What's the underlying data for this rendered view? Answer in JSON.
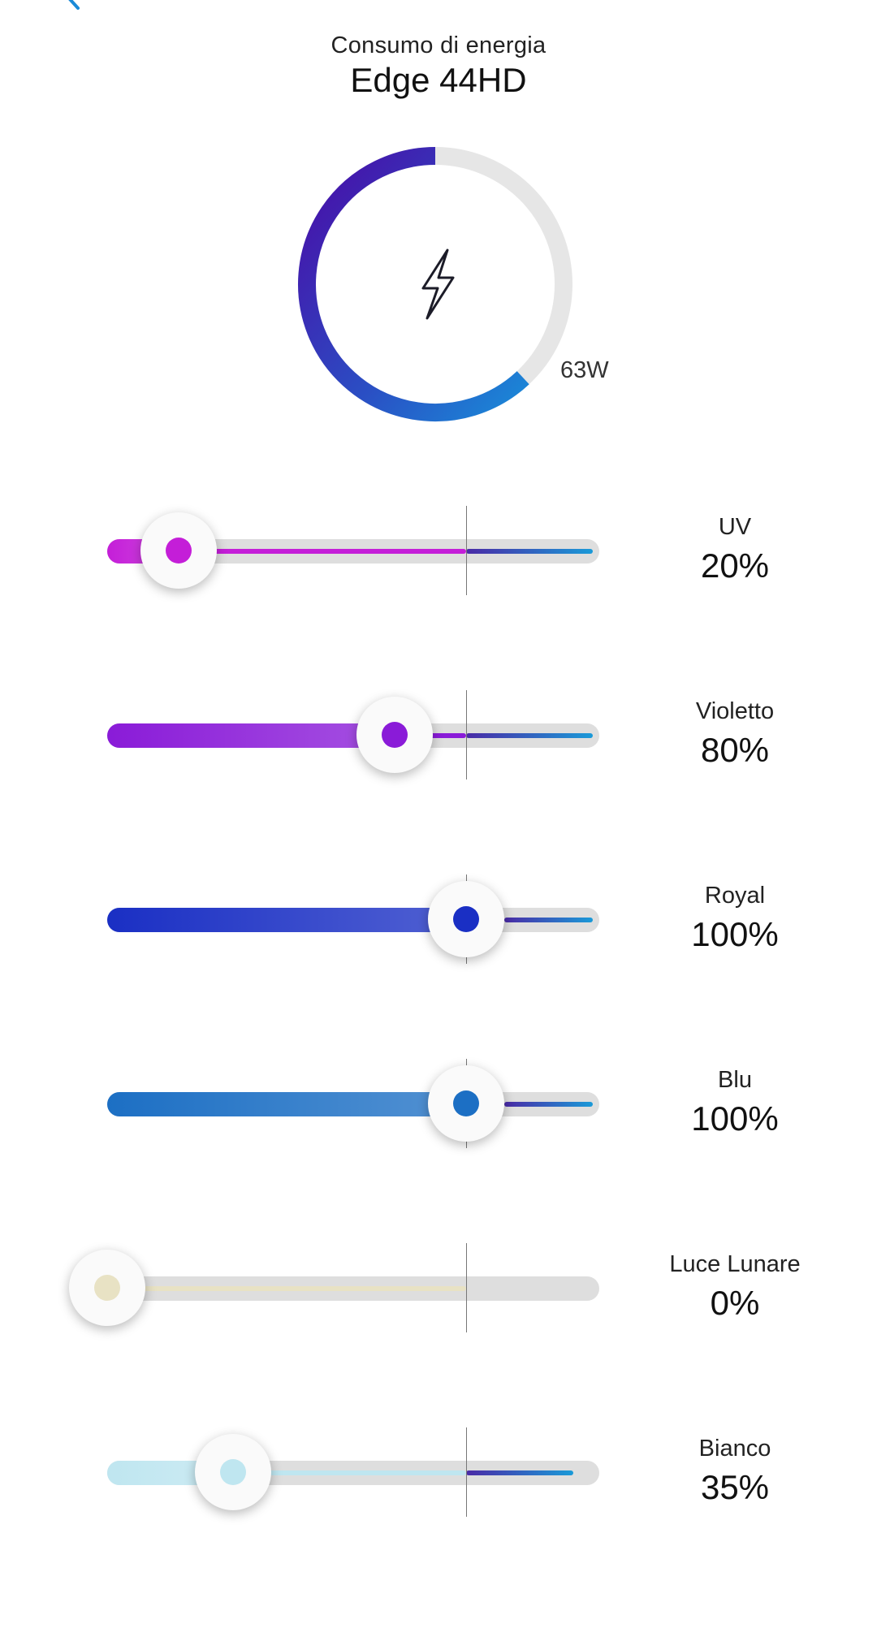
{
  "header": {
    "subtitle": "Consumo di energia",
    "title": "Edge 44HD"
  },
  "power": {
    "value_label": "63W",
    "icon": "lightning-icon",
    "fraction": 0.62
  },
  "channels": [
    {
      "name": "UV",
      "percent": "20%",
      "value": 20,
      "color": "#c41ed8"
    },
    {
      "name": "Violetto",
      "percent": "80%",
      "value": 80,
      "color": "#8a1bd8"
    },
    {
      "name": "Royal",
      "percent": "100%",
      "value": 100,
      "color": "#1a2fc4"
    },
    {
      "name": "Blu",
      "percent": "100%",
      "value": 100,
      "color": "#1c6fc4"
    },
    {
      "name": "Luce Lunare",
      "percent": "0%",
      "value": 0,
      "color": "#e8e2c4"
    },
    {
      "name": "Bianco",
      "percent": "35%",
      "value": 35,
      "color": "#bfe6f0"
    }
  ],
  "colors": {
    "gauge_start": "#4a0aa6",
    "gauge_end": "#1a8ad8",
    "accent": "#1a8ad8"
  }
}
